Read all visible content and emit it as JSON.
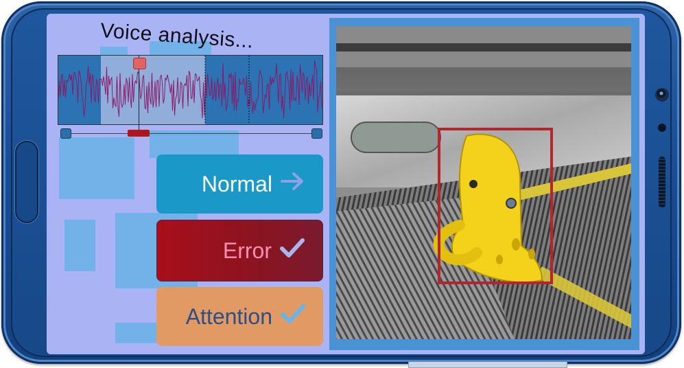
{
  "screen": {
    "title": "Voice analysis...",
    "waveform": {
      "highlight_color": "#bec8eb",
      "wave_color": "#8a1a6a"
    },
    "buttons": [
      {
        "label": "Normal",
        "icon": "arrow-right-icon",
        "color": "#1a98c7"
      },
      {
        "label": "Error",
        "icon": "checkmark-icon",
        "color": "#a80f1a"
      },
      {
        "label": "Attention",
        "icon": "checkmark-icon",
        "color": "#e19a63"
      }
    ],
    "photo": {
      "subject": "yellow clog on escalator step",
      "bbox_color": "#b2262f"
    }
  }
}
